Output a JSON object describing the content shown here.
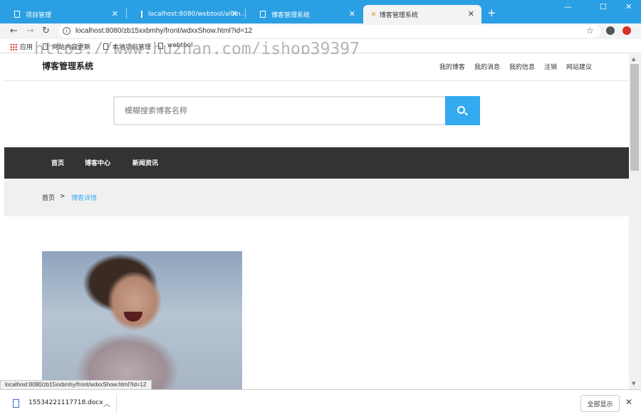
{
  "browser": {
    "tabs": [
      {
        "label": "项目管理"
      },
      {
        "label": "localhost:8080/webtool/all/in..."
      },
      {
        "label": "博客管理系统"
      },
      {
        "label": "博客管理系统"
      }
    ],
    "url": "localhost:8080/zb15xxbmhy/front/wdxxShow.html?id=12",
    "bookmarks": [
      "应用",
      "网站内容更新",
      "本地项目管理",
      "webtool"
    ],
    "watermark": "https://www.huzhan.com/ishop39397",
    "status_url": "localhost:8080/zb15xxbmhy/front/wdxxShow.html?id=12"
  },
  "site": {
    "logo": "博客管理系统",
    "topnav": [
      "我的博客",
      "我的消息",
      "我的信息",
      "注销",
      "网站建议"
    ],
    "search_placeholder": "模糊搜索博客名称",
    "mainnav": [
      "首页",
      "博客中心",
      "新闻资讯"
    ],
    "breadcrumb": {
      "home": "首页",
      "separator": ">",
      "current": "博客详情"
    }
  },
  "downloads": {
    "file": "15534221117718.docx",
    "show_all": "全部显示"
  },
  "colors": {
    "accent": "#34aaf1",
    "nav_bg": "#333333",
    "tabbar": "#2b9fe3"
  }
}
